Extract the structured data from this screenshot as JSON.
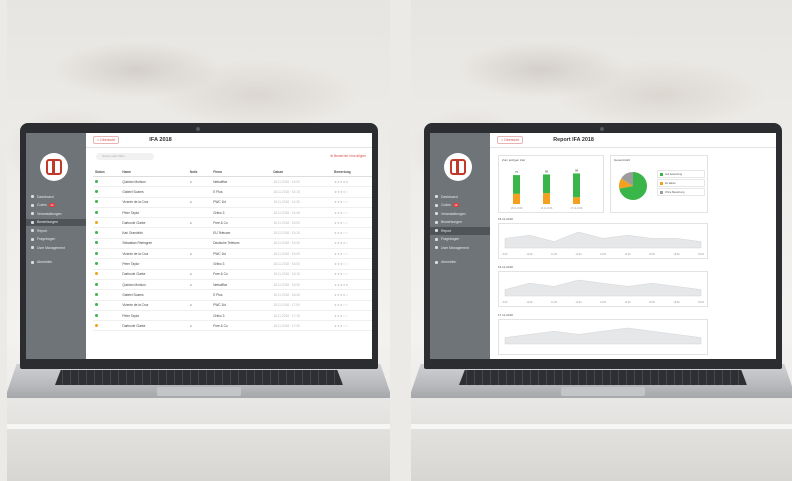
{
  "colors": {
    "sidebar": "#6f7478",
    "accent": "#d9534f",
    "green": "#3ab549",
    "orange": "#f2a01e",
    "grey": "#9c9c9c"
  },
  "left": {
    "sidebar": {
      "items": [
        {
          "label": "Dashboard",
          "icon": "home-icon"
        },
        {
          "label": "Codes",
          "icon": "message-icon",
          "badge": "12"
        },
        {
          "label": "Veranstaltungen",
          "icon": "calendar-icon"
        },
        {
          "label": "Bewerbungen",
          "icon": "users-icon",
          "active": true
        },
        {
          "label": "Report",
          "icon": "chart-icon"
        },
        {
          "label": "Fragebogen",
          "icon": "file-icon"
        },
        {
          "label": "User Management",
          "icon": "gear-icon"
        },
        {
          "label": "Abmelden",
          "icon": "user-icon",
          "gap": true
        }
      ]
    },
    "topbar": {
      "back": "< Übersicht",
      "title": "IFA 2018"
    },
    "search": {
      "placeholder": "Suche oder Filter"
    },
    "add_label": "Bewerber hinzufügen",
    "table": {
      "headers": [
        "Status",
        "Name",
        "Notiz",
        "Firma",
        "Datum",
        "Bewertung"
      ],
      "rows": [
        {
          "status": "green",
          "name": "Quintan Morison",
          "note": "∨",
          "company": "Netsoffice",
          "date": "18.11.2018 · 14:00",
          "rating": "★★★★★"
        },
        {
          "status": "green",
          "name": "Gabriel Soares",
          "note": "",
          "company": "E Plus",
          "date": "18.11.2018 · 14:15",
          "rating": "★★★★☆"
        },
        {
          "status": "green",
          "name": "Vicente de la Cruz",
          "note": "∨",
          "company": "PWC 1kt",
          "date": "18.11.2018 · 14:30",
          "rating": "★★★☆☆"
        },
        {
          "status": "green",
          "name": "Peter Taylor",
          "note": "",
          "company": "Grifco 3",
          "date": "18.11.2018 · 14:45",
          "rating": "★★★☆☆"
        },
        {
          "status": "orange",
          "name": "Darboole Clarke",
          "note": "∨",
          "company": "Free & Co",
          "date": "18.11.2018 · 15:00",
          "rating": "★★★☆☆"
        },
        {
          "status": "green",
          "name": "Kari Grandelin",
          "note": "",
          "company": "EU Telecom",
          "date": "18.11.2018 · 15:15",
          "rating": "★★★☆☆"
        },
        {
          "status": "green",
          "name": "Sebastian Rheingren",
          "note": "",
          "company": "Deutsche Telekom",
          "date": "18.11.2018 · 15:30",
          "rating": "★★★★☆"
        },
        {
          "status": "green",
          "name": "Vicente de la Cruz",
          "note": "∨",
          "company": "PWC 1kt",
          "date": "18.11.2018 · 15:45",
          "rating": "★★★☆☆"
        },
        {
          "status": "green",
          "name": "Peter Taylor",
          "note": "",
          "company": "Grifco 3",
          "date": "18.11.2018 · 16:00",
          "rating": "★★★☆☆"
        },
        {
          "status": "orange",
          "name": "Darboole Clarke",
          "note": "∨",
          "company": "Free & Co",
          "date": "18.11.2018 · 16:15",
          "rating": "★★★☆☆"
        },
        {
          "status": "green",
          "name": "Quintan Morison",
          "note": "∨",
          "company": "Netsoffice",
          "date": "18.11.2018 · 16:30",
          "rating": "★★★★★"
        },
        {
          "status": "green",
          "name": "Gabriel Soares",
          "note": "",
          "company": "E Plus",
          "date": "18.11.2018 · 16:45",
          "rating": "★★★★☆"
        },
        {
          "status": "green",
          "name": "Vicente de la Cruz",
          "note": "∨",
          "company": "PWC 1kt",
          "date": "18.11.2018 · 17:00",
          "rating": "★★★☆☆"
        },
        {
          "status": "green",
          "name": "Peter Taylor",
          "note": "",
          "company": "Grifco 3",
          "date": "18.11.2018 · 17:15",
          "rating": "★★★☆☆"
        },
        {
          "status": "orange",
          "name": "Darboole Clarke",
          "note": "∨",
          "company": "Free & Co",
          "date": "18.11.2018 · 17:30",
          "rating": "★★★☆☆"
        }
      ]
    }
  },
  "right": {
    "sidebar": {
      "items": [
        {
          "label": "Dashboard",
          "icon": "home-icon"
        },
        {
          "label": "Codes",
          "icon": "message-icon",
          "badge": "12"
        },
        {
          "label": "Veranstaltungen",
          "icon": "calendar-icon"
        },
        {
          "label": "Bewerbungen",
          "icon": "users-icon"
        },
        {
          "label": "Report",
          "icon": "chart-icon",
          "active": true
        },
        {
          "label": "Fragebogen",
          "icon": "file-icon"
        },
        {
          "label": "User Management",
          "icon": "gear-icon"
        },
        {
          "label": "Abmelden",
          "icon": "user-icon",
          "gap": true
        }
      ]
    },
    "topbar": {
      "back": "< Übersicht",
      "title": "Report IFA 2018"
    },
    "bar_card": {
      "title": "Zum jetzigen Zeit",
      "bars": [
        {
          "label": "75",
          "x": "15.11.2018",
          "green": 0.55,
          "orange": 0.3
        },
        {
          "label": "88",
          "x": "16.11.2018",
          "green": 0.55,
          "orange": 0.32
        },
        {
          "label": "98",
          "x": "17.11.2018",
          "green": 0.7,
          "orange": 0.2
        }
      ]
    },
    "pie_card": {
      "title": "Gesamtzahl",
      "legend": [
        {
          "label": "Gut bewertung",
          "color": "#3ab549"
        },
        {
          "label": "Zu klären",
          "color": "#f2a01e"
        },
        {
          "label": "Ohne Bewertung",
          "color": "#9c9c9c"
        }
      ],
      "slices": [
        0.72,
        0.12,
        0.16
      ]
    },
    "line_sections": [
      {
        "title": "15.11.2018",
        "ticks": [
          "8:00",
          "10:00",
          "11:00",
          "12:00",
          "13:00",
          "14:00",
          "15:00",
          "16:00",
          "18:00"
        ],
        "values": [
          3,
          4,
          2,
          5,
          3,
          4,
          3,
          3,
          2
        ]
      },
      {
        "title": "16.11.2018",
        "ticks": [
          "8:00",
          "10:00",
          "11:00",
          "12:00",
          "13:00",
          "14:00",
          "15:00",
          "16:00",
          "18:00"
        ],
        "values": [
          2,
          4,
          3,
          5,
          4,
          3,
          4,
          3,
          2
        ]
      },
      {
        "title": "17.11.2018",
        "ticks": [],
        "values": [
          2,
          3,
          4,
          3,
          4,
          5,
          4,
          3,
          2
        ]
      }
    ]
  }
}
